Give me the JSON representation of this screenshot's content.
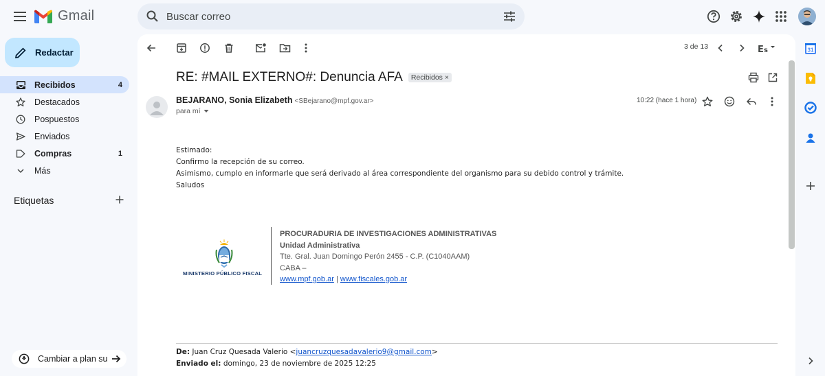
{
  "app": {
    "name": "Gmail"
  },
  "search": {
    "placeholder": "Buscar correo"
  },
  "compose": {
    "label": "Redactar"
  },
  "nav": {
    "items": [
      {
        "label": "Recibidos",
        "count": "4",
        "icon": "inbox-icon",
        "active": true,
        "bold": true
      },
      {
        "label": "Destacados",
        "count": "",
        "icon": "star-icon"
      },
      {
        "label": "Pospuestos",
        "count": "",
        "icon": "clock-icon"
      },
      {
        "label": "Enviados",
        "count": "",
        "icon": "send-icon"
      },
      {
        "label": "Compras",
        "count": "1",
        "icon": "tag-icon",
        "bold": true
      },
      {
        "label": "Más",
        "count": "",
        "icon": "chevron-down-icon"
      }
    ]
  },
  "labels": {
    "title": "Etiquetas"
  },
  "upgrade": {
    "label": "Cambiar a plan superior"
  },
  "toolbar": {
    "pager": "3 de 13"
  },
  "email": {
    "subject": "RE: #MAIL EXTERNO#: Denuncia AFA",
    "chip": "Recibidos",
    "chip_close": "×",
    "sender_name": "BEJARANO, Sonia Elizabeth",
    "sender_email": "<SBejarano@mpf.gov.ar>",
    "to": "para mí",
    "time": "10:22 (hace 1 hora)",
    "body": [
      "Estimado:",
      "Confirmo la recepción de su correo.",
      "Asimismo, cumplo en informarle que será derivado al área correspondiente del organismo para su debido control y trámite.",
      "Saludos"
    ],
    "signature": {
      "logo_text": "MINISTERIO PÚBLICO FISCAL",
      "org": "PROCURADURIA DE INVESTIGACIONES ADMINISTRATIVAS",
      "unit": "Unidad Administrativa",
      "address": "Tte. Gral. Juan Domingo Perón 2455 - C.P. (C1040AAM)",
      "city": "CABA –",
      "link1": "www.mpf.gob.ar",
      "separator": "|",
      "link2": "www.fiscales.gob.ar"
    },
    "forwarded": {
      "from_label": "De:",
      "from_name": "Juan Cruz Quesada Valerio <",
      "from_email": "juancruzquesadavalerio9@gmail.com",
      "from_end": ">",
      "sent_label": "Enviado el:",
      "sent_value": "domingo, 23 de noviembre de 2025 12:25"
    }
  },
  "colors": {
    "active_nav": "#d3e3fd",
    "compose": "#c2e7ff",
    "link": "#1155cc",
    "background": "#f6f8fc"
  }
}
